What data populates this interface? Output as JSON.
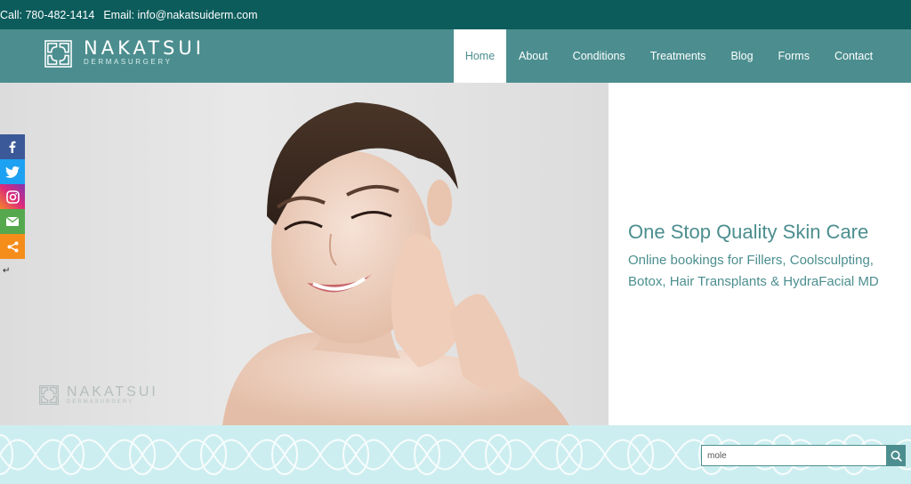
{
  "topbar": {
    "call": "Call: 780-482-1414",
    "email": "Email: info@nakatsuiderm.com"
  },
  "logo": {
    "name": "NAKATSUI",
    "subtitle": "DERMASURGERY"
  },
  "nav": {
    "items": [
      {
        "label": "Home",
        "active": true
      },
      {
        "label": "About"
      },
      {
        "label": "Conditions"
      },
      {
        "label": "Treatments"
      },
      {
        "label": "Blog"
      },
      {
        "label": "Forms"
      },
      {
        "label": "Contact"
      }
    ]
  },
  "hero": {
    "title": "One Stop Quality Skin Care",
    "subtitle": "Online bookings for Fillers, Coolsculpting, Botox, Hair Transplants & HydraFacial MD",
    "watermark_name": "NAKATSUI",
    "watermark_sub": "DERMASURGERY"
  },
  "social": {
    "icons": [
      "facebook-icon",
      "twitter-icon",
      "instagram-icon",
      "email-icon",
      "share-icon"
    ],
    "collapse_glyph": "↵"
  },
  "search": {
    "value": "mole"
  },
  "colors": {
    "topbar": "#0d5c5c",
    "nav": "#4c8e8f",
    "strip": "#cdeef0"
  }
}
